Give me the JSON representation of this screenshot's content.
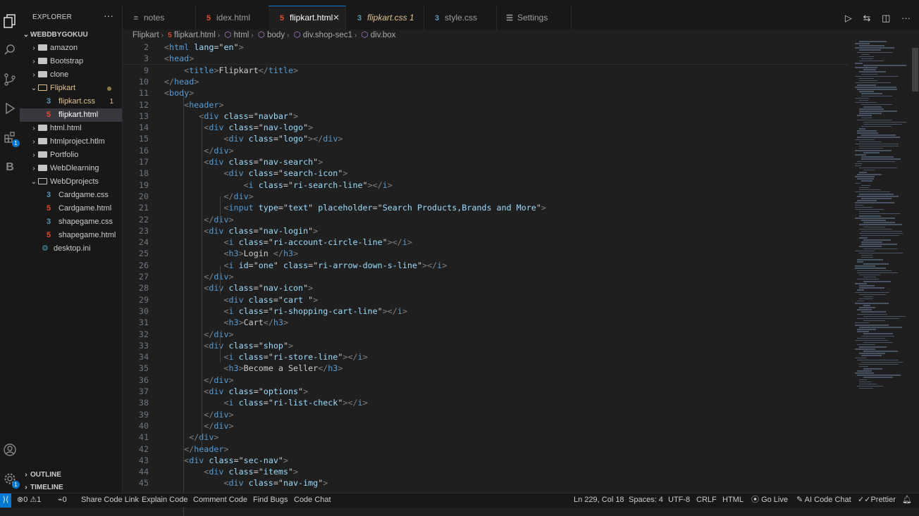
{
  "sidebar": {
    "title": "EXPLORER",
    "more": "···",
    "root": "WEBDBYGOKUU",
    "items": [
      {
        "label": "amazon",
        "kind": "folder"
      },
      {
        "label": "Bootstrap",
        "kind": "folder"
      },
      {
        "label": "clone",
        "kind": "folder"
      },
      {
        "label": "Flipkart",
        "kind": "folder-open"
      },
      {
        "label": "flipkart.css",
        "kind": "css",
        "badge": "1"
      },
      {
        "label": "flipkart.html",
        "kind": "html"
      },
      {
        "label": "html.html",
        "kind": "folder"
      },
      {
        "label": "htmlproject.htlm",
        "kind": "folder"
      },
      {
        "label": "Portfolio",
        "kind": "folder"
      },
      {
        "label": "WebDlearning",
        "kind": "folder"
      },
      {
        "label": "WebDprojects",
        "kind": "folder-open"
      },
      {
        "label": "Cardgame.css",
        "kind": "css"
      },
      {
        "label": "Cardgame.html",
        "kind": "html"
      },
      {
        "label": "shapegame.css",
        "kind": "css"
      },
      {
        "label": "shapegame.html",
        "kind": "html"
      },
      {
        "label": "desktop.ini",
        "kind": "ini"
      }
    ],
    "outline": "OUTLINE",
    "timeline": "TIMELINE"
  },
  "activity": {
    "extensions_badge": "1",
    "account_badge": "1"
  },
  "tabs": [
    {
      "label": "notes",
      "icon": "≡"
    },
    {
      "label": "idex.html",
      "icon": "5"
    },
    {
      "label": "flipkart.html",
      "icon": "5",
      "close": "✕"
    },
    {
      "label": "flipkart.css 1",
      "icon": "3"
    },
    {
      "label": "style.css",
      "icon": "3"
    },
    {
      "label": "Settings",
      "icon": "☰"
    }
  ],
  "breadcrumb": {
    "folder": "Flipkart",
    "file": "flipkart.html",
    "html": "html",
    "body": "body",
    "shop": "div.shop-sec1",
    "box": "div.box"
  },
  "code_lines": [
    {
      "n": "2",
      "t": "<html lang=\"en\">"
    },
    {
      "n": "3",
      "t": "<head>"
    },
    {
      "n": "9",
      "t": "    <title>Flipkart</title>"
    },
    {
      "n": "10",
      "t": "</head>"
    },
    {
      "n": "11",
      "t": "<body>"
    },
    {
      "n": "12",
      "t": "    <header>"
    },
    {
      "n": "13",
      "t": "       <div class=\"navbar\">"
    },
    {
      "n": "14",
      "t": "        <div class=\"nav-logo\">"
    },
    {
      "n": "15",
      "t": "            <div class=\"logo\"></div>"
    },
    {
      "n": "16",
      "t": "        </div>"
    },
    {
      "n": "17",
      "t": "        <div class=\"nav-search\">"
    },
    {
      "n": "18",
      "t": "            <div class=\"search-icon\">"
    },
    {
      "n": "19",
      "t": "                <i class=\"ri-search-line\"></i>"
    },
    {
      "n": "20",
      "t": "            </div>"
    },
    {
      "n": "21",
      "t": "            <input type=\"text\" placeholder=\"Search Products,Brands and More\">"
    },
    {
      "n": "22",
      "t": "        </div>"
    },
    {
      "n": "23",
      "t": "        <div class=\"nav-login\">"
    },
    {
      "n": "24",
      "t": "            <i class=\"ri-account-circle-line\"></i>"
    },
    {
      "n": "25",
      "t": "            <h3>Login </h3>"
    },
    {
      "n": "26",
      "t": "            <i id=\"one\" class=\"ri-arrow-down-s-line\"></i>"
    },
    {
      "n": "27",
      "t": "        </div>"
    },
    {
      "n": "28",
      "t": "        <div class=\"nav-icon\">"
    },
    {
      "n": "29",
      "t": "            <div class=\"cart \">"
    },
    {
      "n": "30",
      "t": "            <i class=\"ri-shopping-cart-line\"></i>"
    },
    {
      "n": "31",
      "t": "            <h3>Cart</h3>"
    },
    {
      "n": "32",
      "t": "        </div>"
    },
    {
      "n": "33",
      "t": "        <div class=\"shop\">"
    },
    {
      "n": "34",
      "t": "            <i class=\"ri-store-line\"></i>"
    },
    {
      "n": "35",
      "t": "            <h3>Become a Seller</h3>"
    },
    {
      "n": "36",
      "t": "        </div>"
    },
    {
      "n": "37",
      "t": "        <div class=\"options\">"
    },
    {
      "n": "38",
      "t": "            <i class=\"ri-list-check\"></i>"
    },
    {
      "n": "39",
      "t": "        </div>"
    },
    {
      "n": "40",
      "t": "        </div>"
    },
    {
      "n": "41",
      "t": "     </div>"
    },
    {
      "n": "42",
      "t": "    </header>"
    },
    {
      "n": "43",
      "t": "    <div class=\"sec-nav\">"
    },
    {
      "n": "44",
      "t": "        <div class=\"items\">"
    },
    {
      "n": "45",
      "t": "            <div class=\"nav-img\">"
    }
  ],
  "status": {
    "errors": "0",
    "warnings": "1",
    "ports": "0",
    "share": "Share Code Link",
    "explain": "Explain Code",
    "comment": "Comment Code",
    "bugs": "Find Bugs",
    "chat": "Code Chat",
    "position": "Ln 229, Col 18",
    "spaces": "Spaces: 4",
    "encoding": "UTF-8",
    "eol": "CRLF",
    "language": "HTML",
    "golive": "Go Live",
    "aichat": "AI Code Chat",
    "prettier": "Prettier"
  },
  "colors": {
    "accent": "#0078d4",
    "tag": "#569cd6",
    "attr": "#9cdcfe",
    "string": "#ce9178",
    "modified": "#e2c08d"
  }
}
